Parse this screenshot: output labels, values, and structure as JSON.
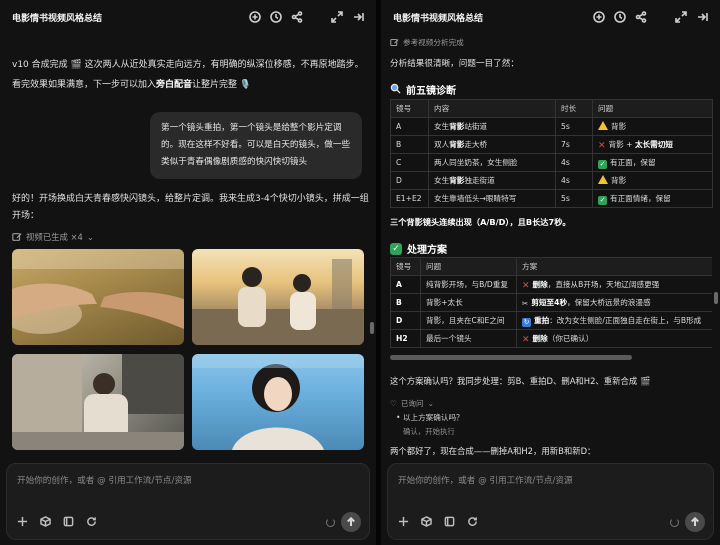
{
  "left": {
    "title": "电影情书视频风格总结",
    "msg1_line1": "v10 合成完成 🎬 这次两人从近处真实走向远方，有明确的纵深位移感，不再原地踏步。",
    "msg1_line2_a": "看完效果如果满意，下一步可以加入",
    "msg1_line2_bold": "旁白配音",
    "msg1_line2_b": "让整片完整 🎙️",
    "bubble": "第一个镜头重拍，第一个镜头是给整个影片定调的。现在这样不好看。可以是白天的镜头，做一些类似于青春偶像剧质感的快闪快切镜头",
    "reply_line1": "好的！开场换成白天青春感快闪镜头，给整片定调。我来生成3-4个快切小镜头，拼成一组",
    "reply_line2": "开场：",
    "gen_label": "视频已生成 ×4",
    "composer_placeholder": "开始你的创作，或者 @ 引用工作流/节点/资源"
  },
  "right": {
    "title": "电影情书视频风格总结",
    "ref_done": "参考视频分析完成",
    "intro": "分析结果很清晰，问题一目了然：",
    "diag_title": "前五镜诊断",
    "diag_headers": [
      "镜号",
      "内容",
      "时长",
      "问题"
    ],
    "diag_rows": [
      {
        "id": "A",
        "content_a": "女生",
        "content_b": "背影",
        "content_c": "站街道",
        "dur": "5s",
        "icon": "warn",
        "issue_a": "背影",
        "issue_b": ""
      },
      {
        "id": "B",
        "content_a": "双人",
        "content_b": "背影",
        "content_c": "走大桥",
        "dur": "7s",
        "icon": "x",
        "issue_a": "背影 + ",
        "issue_b": "太长需切短"
      },
      {
        "id": "C",
        "content_a": "两人同坐奶茶，女生侧脸",
        "content_b": "",
        "content_c": "",
        "dur": "4s",
        "icon": "ok",
        "issue_a": "有正面，保留",
        "issue_b": ""
      },
      {
        "id": "D",
        "content_a": "女生",
        "content_b": "背影",
        "content_c": "独走街道",
        "dur": "4s",
        "icon": "warn",
        "issue_a": "背影",
        "issue_b": ""
      },
      {
        "id": "E1+E2",
        "content_a": "女生靠墙低头→眼睛特写",
        "content_b": "",
        "content_c": "",
        "dur": "5s",
        "icon": "ok",
        "issue_a": "有正面情绪，保留",
        "issue_b": ""
      }
    ],
    "diag_note": "三个背影镜头连续出现（A/B/D），且B长达7秒。",
    "plan_title": "处理方案",
    "plan_headers": [
      "镜号",
      "问题",
      "方案"
    ],
    "plan_rows": [
      {
        "id": "A",
        "issue": "纯背影开场，与B/D重复",
        "icon": "x",
        "plan_b": "删除",
        "plan_c": "，直接从B开场，天地辽阔感更强"
      },
      {
        "id": "B",
        "issue": "背影+太长",
        "icon": "cut",
        "plan_b": "剪短至4秒",
        "plan_c": "，保留大桥远景的浪漫感"
      },
      {
        "id": "D",
        "issue": "背影，且夹在C和E之间",
        "icon": "cycle",
        "plan_b": "重拍",
        "plan_c": "：改为女生侧脸/正面独自走在街上，与B形成"
      },
      {
        "id": "H2",
        "issue": "最后一个镜头",
        "icon": "x",
        "plan_b": "删除",
        "plan_c": "（你已确认）"
      }
    ],
    "confirm": "这个方案确认吗？我同步处理：剪B、重拍D、删A和H2、重新合成 🎬",
    "asked_label": "已询问",
    "ask_q": "以上方案确认吗？",
    "ask_a": "确认，开始执行",
    "final_line": "两个都好了，现在合成——删掉A和H2，用新B和新D：",
    "composer_placeholder": "开始你的创作，或者 @ 引用工作流/节点/资源"
  }
}
